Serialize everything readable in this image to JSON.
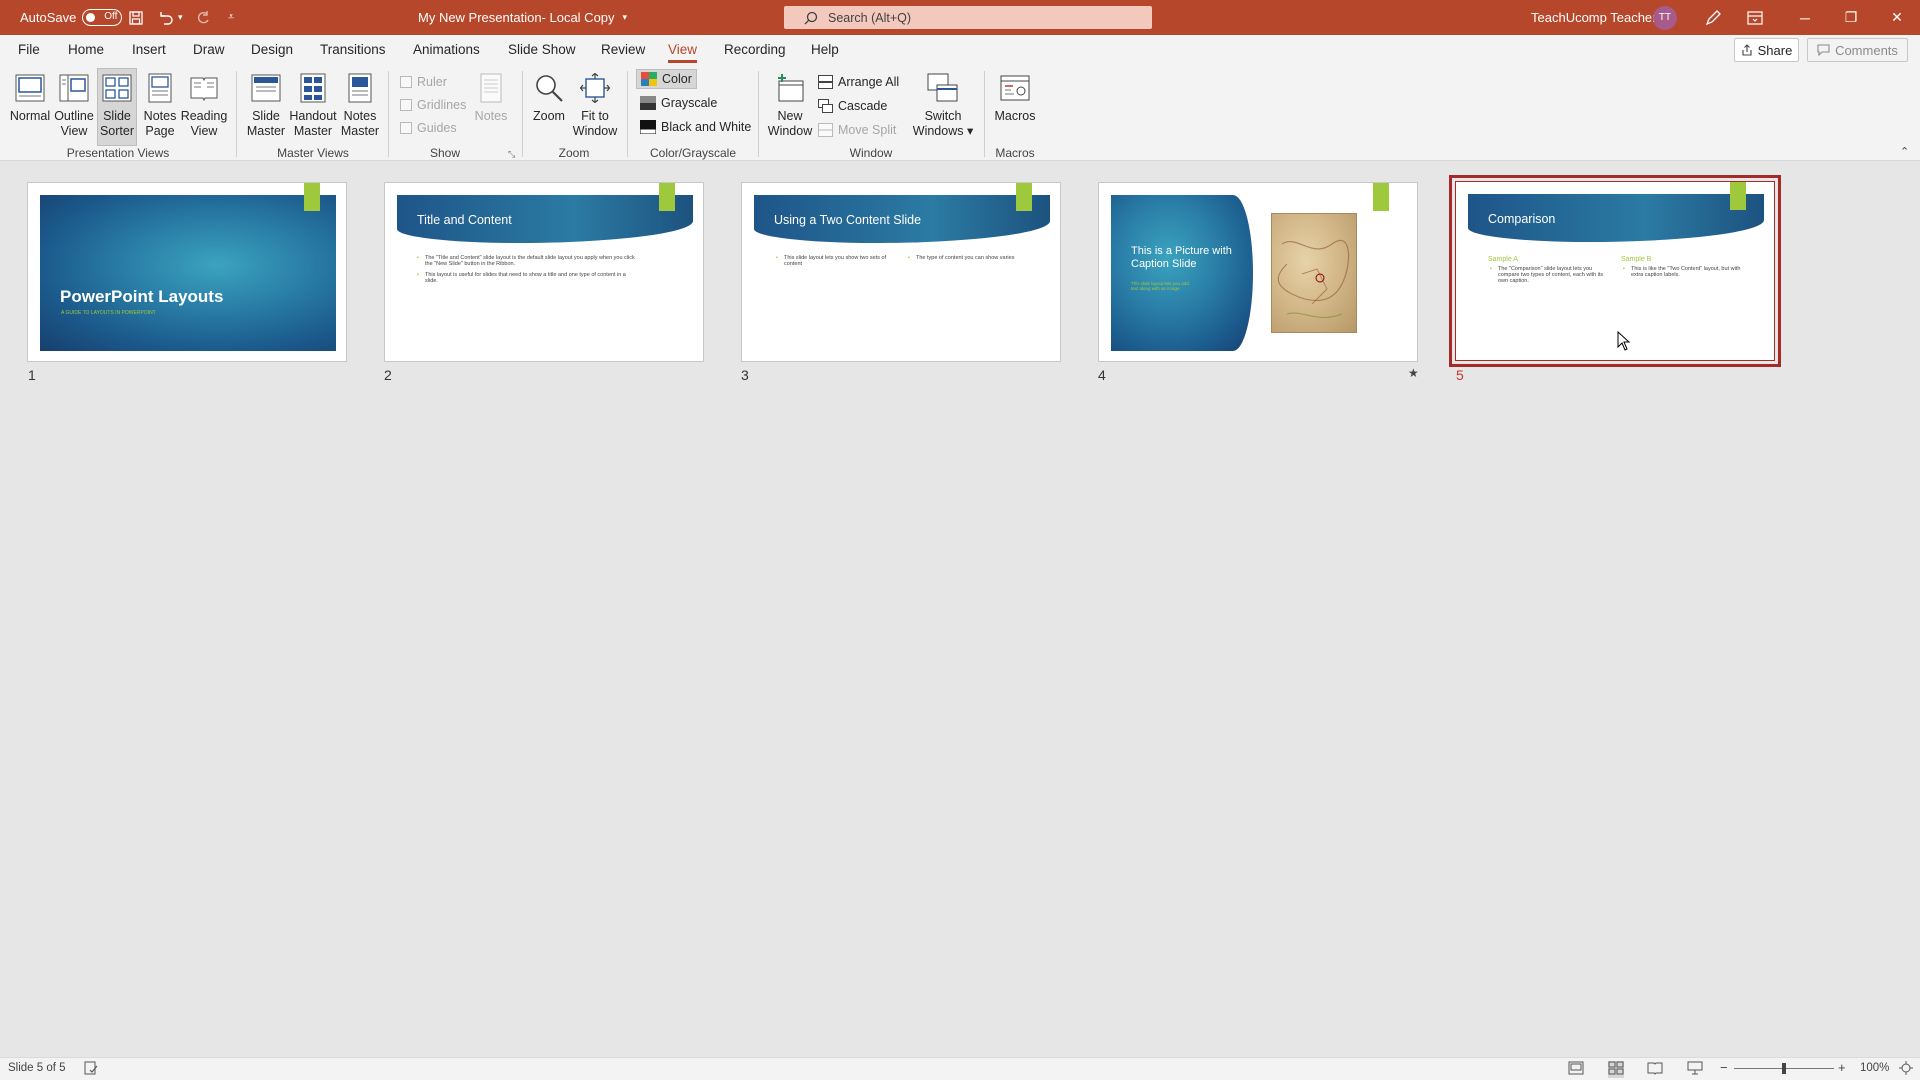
{
  "titlebar": {
    "autosave_label": "AutoSave",
    "autosave_state": "Off",
    "doc_title": "My New Presentation- Local Copy",
    "search_placeholder": "Search (Alt+Q)",
    "user_name": "TeachUcomp Teacher",
    "user_initials": "TT"
  },
  "tabs": [
    "File",
    "Home",
    "Insert",
    "Draw",
    "Design",
    "Transitions",
    "Animations",
    "Slide Show",
    "Review",
    "View",
    "Recording",
    "Help"
  ],
  "active_tab": "View",
  "share_label": "Share",
  "comments_label": "Comments",
  "ribbon": {
    "presentation_views": {
      "label": "Presentation Views",
      "normal": [
        "Normal",
        ""
      ],
      "outline": [
        "Outline",
        "View"
      ],
      "slide_sorter": [
        "Slide",
        "Sorter"
      ],
      "notes_page": [
        "Notes",
        "Page"
      ],
      "reading_view": [
        "Reading",
        "View"
      ]
    },
    "master_views": {
      "label": "Master Views",
      "slide_master": [
        "Slide",
        "Master"
      ],
      "handout_master": [
        "Handout",
        "Master"
      ],
      "notes_master": [
        "Notes",
        "Master"
      ]
    },
    "show": {
      "label": "Show",
      "ruler": "Ruler",
      "gridlines": "Gridlines",
      "guides": "Guides",
      "notes": "Notes"
    },
    "zoom": {
      "label": "Zoom",
      "zoom": "Zoom",
      "fit_to_window": [
        "Fit to",
        "Window"
      ]
    },
    "color": {
      "label": "Color/Grayscale",
      "color": "Color",
      "grayscale": "Grayscale",
      "bw": "Black and White"
    },
    "window": {
      "label": "Window",
      "new_window": [
        "New",
        "Window"
      ],
      "arrange_all": "Arrange All",
      "cascade": "Cascade",
      "move_split": "Move Split",
      "switch_windows": [
        "Switch",
        "Windows"
      ]
    },
    "macros": {
      "label": "Macros",
      "macros": "Macros"
    }
  },
  "slides": [
    {
      "number": "1",
      "title": "PowerPoint Layouts",
      "subtitle": "A GUIDE TO LAYOUTS IN POWERPOINT"
    },
    {
      "number": "2",
      "title": "Title and Content",
      "bullets": [
        "The \"Title and Content\" slide layout is the default slide layout you apply when you click the \"New Slide\" button in the Ribbon.",
        "This layout is useful for slides that need to show a title and one type of content in a slide."
      ]
    },
    {
      "number": "3",
      "title": "Using a Two Content Slide",
      "left": "This slide layout lets you show two sets of content",
      "right": "The type of content you can show varies"
    },
    {
      "number": "4",
      "title": "This is a Picture with Caption Slide",
      "caption": "This slide layout lets you add text along with an image"
    },
    {
      "number": "5",
      "title": "Comparison",
      "head_a": "Sample A",
      "head_b": "Sample B",
      "text_a": "The \"Comparison\" slide layout lets you compare two types of content, each with its own caption.",
      "text_b": "This is like the \"Two Content\" layout, but with extra caption labels."
    }
  ],
  "status": {
    "slide_info": "Slide 5 of 5",
    "zoom_level": "100%"
  },
  "colors": {
    "accent": "#b7472a",
    "selection": "#a52a2a",
    "slide_green": "#9fc93c"
  }
}
